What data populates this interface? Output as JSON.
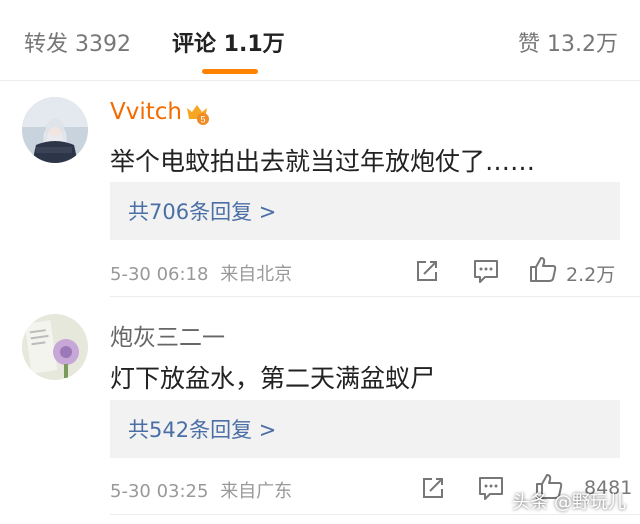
{
  "tabs": {
    "repost": "转发 3392",
    "comments": "评论 1.1万",
    "likes": "赞 13.2万"
  },
  "comments": [
    {
      "username": "Vvitch",
      "badge_level": "5",
      "text": "举个电蚊拍出去就当过年放炮仗了……",
      "replies": "共706条回复 >",
      "time": "5-30 06:18",
      "location": "来自北京",
      "likes": "2.2万"
    },
    {
      "username": "炮灰三二一",
      "text": "灯下放盆水，第二天满盆蚁尸",
      "replies": "共542条回复 >",
      "time": "5-30 03:25",
      "location": "来自广东",
      "likes": "8481"
    }
  ],
  "watermark": "头条 @野玩儿",
  "colors": {
    "accent": "#ff8200",
    "vip_name": "#f46b00",
    "link": "#4a6fa5"
  }
}
